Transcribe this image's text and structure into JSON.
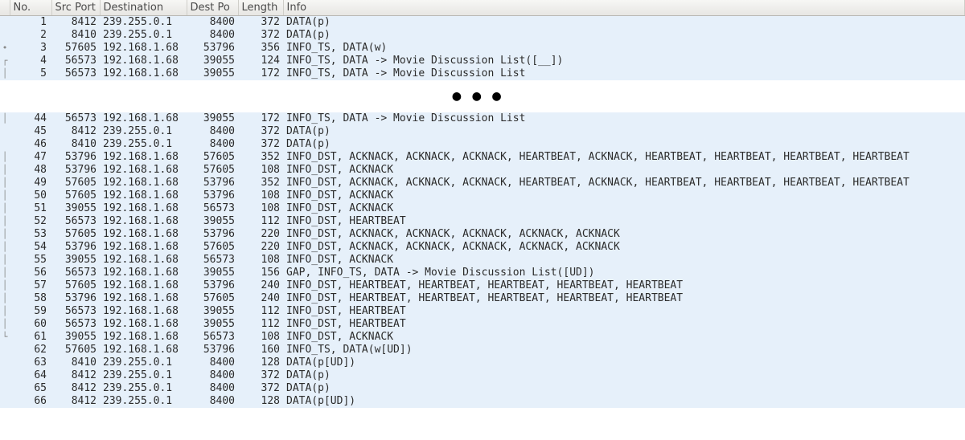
{
  "columns": {
    "no": "No.",
    "src": "Src Port",
    "dst": "Destination",
    "dp": "Dest Po",
    "len": "Length",
    "info": "Info"
  },
  "ellipsis": "●●●",
  "rows_top": [
    {
      "mark": "",
      "no": "1",
      "src": "8412",
      "dst": "239.255.0.1",
      "dp": "8400",
      "len": "372",
      "info": "DATA(p)"
    },
    {
      "mark": "",
      "no": "2",
      "src": "8410",
      "dst": "239.255.0.1",
      "dp": "8400",
      "len": "372",
      "info": "DATA(p)"
    },
    {
      "mark": "•",
      "no": "3",
      "src": "57605",
      "dst": "192.168.1.68",
      "dp": "53796",
      "len": "356",
      "info": "INFO_TS, DATA(w)"
    },
    {
      "mark": "┌",
      "no": "4",
      "src": "56573",
      "dst": "192.168.1.68",
      "dp": "39055",
      "len": "124",
      "info": "INFO_TS, DATA -> Movie Discussion List([__])"
    },
    {
      "mark": "│",
      "no": "5",
      "src": "56573",
      "dst": "192.168.1.68",
      "dp": "39055",
      "len": "172",
      "info": "INFO_TS, DATA -> Movie Discussion List"
    }
  ],
  "rows_bottom": [
    {
      "mark": "│",
      "no": "44",
      "src": "56573",
      "dst": "192.168.1.68",
      "dp": "39055",
      "len": "172",
      "info": "INFO_TS, DATA -> Movie Discussion List"
    },
    {
      "mark": "",
      "no": "45",
      "src": "8412",
      "dst": "239.255.0.1",
      "dp": "8400",
      "len": "372",
      "info": "DATA(p)"
    },
    {
      "mark": "",
      "no": "46",
      "src": "8410",
      "dst": "239.255.0.1",
      "dp": "8400",
      "len": "372",
      "info": "DATA(p)"
    },
    {
      "mark": "│",
      "no": "47",
      "src": "53796",
      "dst": "192.168.1.68",
      "dp": "57605",
      "len": "352",
      "info": "INFO_DST, ACKNACK, ACKNACK, ACKNACK, HEARTBEAT, ACKNACK, HEARTBEAT, HEARTBEAT, HEARTBEAT, HEARTBEAT"
    },
    {
      "mark": "│",
      "no": "48",
      "src": "53796",
      "dst": "192.168.1.68",
      "dp": "57605",
      "len": "108",
      "info": "INFO_DST, ACKNACK"
    },
    {
      "mark": "│",
      "no": "49",
      "src": "57605",
      "dst": "192.168.1.68",
      "dp": "53796",
      "len": "352",
      "info": "INFO_DST, ACKNACK, ACKNACK, ACKNACK, HEARTBEAT, ACKNACK, HEARTBEAT, HEARTBEAT, HEARTBEAT, HEARTBEAT"
    },
    {
      "mark": "│",
      "no": "50",
      "src": "57605",
      "dst": "192.168.1.68",
      "dp": "53796",
      "len": "108",
      "info": "INFO_DST, ACKNACK"
    },
    {
      "mark": "│",
      "no": "51",
      "src": "39055",
      "dst": "192.168.1.68",
      "dp": "56573",
      "len": "108",
      "info": "INFO_DST, ACKNACK"
    },
    {
      "mark": "│",
      "no": "52",
      "src": "56573",
      "dst": "192.168.1.68",
      "dp": "39055",
      "len": "112",
      "info": "INFO_DST, HEARTBEAT"
    },
    {
      "mark": "│",
      "no": "53",
      "src": "57605",
      "dst": "192.168.1.68",
      "dp": "53796",
      "len": "220",
      "info": "INFO_DST, ACKNACK, ACKNACK, ACKNACK, ACKNACK, ACKNACK"
    },
    {
      "mark": "│",
      "no": "54",
      "src": "53796",
      "dst": "192.168.1.68",
      "dp": "57605",
      "len": "220",
      "info": "INFO_DST, ACKNACK, ACKNACK, ACKNACK, ACKNACK, ACKNACK"
    },
    {
      "mark": "│",
      "no": "55",
      "src": "39055",
      "dst": "192.168.1.68",
      "dp": "56573",
      "len": "108",
      "info": "INFO_DST, ACKNACK"
    },
    {
      "mark": "│",
      "no": "56",
      "src": "56573",
      "dst": "192.168.1.68",
      "dp": "39055",
      "len": "156",
      "info": "GAP, INFO_TS, DATA -> Movie Discussion List([UD])"
    },
    {
      "mark": "│",
      "no": "57",
      "src": "57605",
      "dst": "192.168.1.68",
      "dp": "53796",
      "len": "240",
      "info": "INFO_DST, HEARTBEAT, HEARTBEAT, HEARTBEAT, HEARTBEAT, HEARTBEAT"
    },
    {
      "mark": "│",
      "no": "58",
      "src": "53796",
      "dst": "192.168.1.68",
      "dp": "57605",
      "len": "240",
      "info": "INFO_DST, HEARTBEAT, HEARTBEAT, HEARTBEAT, HEARTBEAT, HEARTBEAT"
    },
    {
      "mark": "│",
      "no": "59",
      "src": "56573",
      "dst": "192.168.1.68",
      "dp": "39055",
      "len": "112",
      "info": "INFO_DST, HEARTBEAT"
    },
    {
      "mark": "│",
      "no": "60",
      "src": "56573",
      "dst": "192.168.1.68",
      "dp": "39055",
      "len": "112",
      "info": "INFO_DST, HEARTBEAT"
    },
    {
      "mark": "└",
      "no": "61",
      "src": "39055",
      "dst": "192.168.1.68",
      "dp": "56573",
      "len": "108",
      "info": "INFO_DST, ACKNACK"
    },
    {
      "mark": "",
      "no": "62",
      "src": "57605",
      "dst": "192.168.1.68",
      "dp": "53796",
      "len": "160",
      "info": "INFO_TS, DATA(w[UD])"
    },
    {
      "mark": "",
      "no": "63",
      "src": "8410",
      "dst": "239.255.0.1",
      "dp": "8400",
      "len": "128",
      "info": "DATA(p[UD])"
    },
    {
      "mark": "",
      "no": "64",
      "src": "8412",
      "dst": "239.255.0.1",
      "dp": "8400",
      "len": "372",
      "info": "DATA(p)"
    },
    {
      "mark": "",
      "no": "65",
      "src": "8412",
      "dst": "239.255.0.1",
      "dp": "8400",
      "len": "372",
      "info": "DATA(p)"
    },
    {
      "mark": "",
      "no": "66",
      "src": "8412",
      "dst": "239.255.0.1",
      "dp": "8400",
      "len": "128",
      "info": "DATA(p[UD])"
    }
  ]
}
